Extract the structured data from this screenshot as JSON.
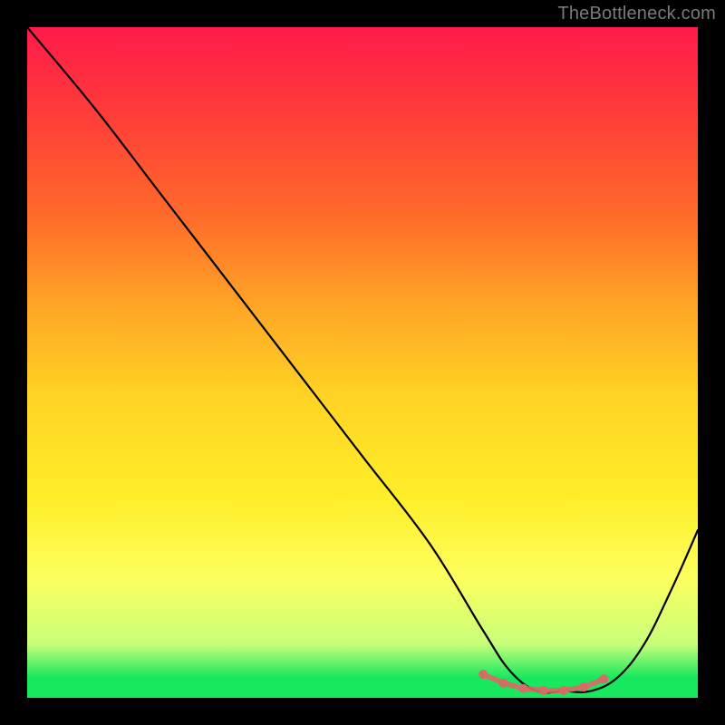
{
  "watermark": "TheBottleneck.com",
  "chart_data": {
    "type": "line",
    "title": "",
    "xlabel": "",
    "ylabel": "",
    "xlim": [
      0,
      100
    ],
    "ylim": [
      0,
      100
    ],
    "series": [
      {
        "name": "bottleneck-curve",
        "x": [
          0,
          10,
          20,
          30,
          40,
          50,
          60,
          68,
          72,
          76,
          80,
          84,
          88,
          92,
          96,
          100
        ],
        "values": [
          100,
          88,
          75,
          62,
          49,
          36,
          23,
          10,
          4,
          1,
          1,
          1,
          3,
          8,
          16,
          25
        ]
      }
    ],
    "markers": {
      "name": "optimal-range",
      "color": "#d96a66",
      "x": [
        68,
        71,
        74,
        77,
        80,
        83,
        86
      ],
      "values": [
        3.5,
        2.2,
        1.4,
        1.1,
        1.1,
        1.6,
        2.8
      ]
    }
  }
}
